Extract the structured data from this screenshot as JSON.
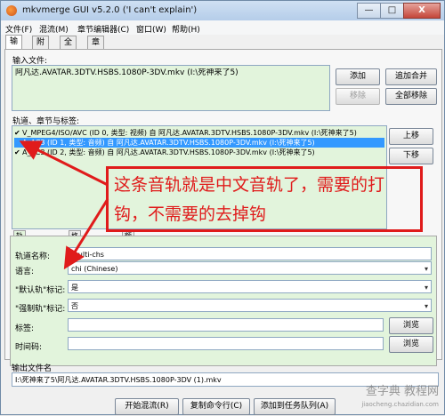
{
  "window": {
    "title": "mkvmerge GUI v5.2.0 ('I can't explain')"
  },
  "window_controls": {
    "minimize": "—",
    "maximize": "□",
    "close": "X"
  },
  "menu": [
    "文件(F)",
    "混流(M)",
    "章节编辑器(C)",
    "窗口(W)",
    "帮助(H)"
  ],
  "tabs": [
    "输入",
    "附件",
    "全局",
    "章节编辑器"
  ],
  "input": {
    "label": "输入文件:",
    "files": [
      "阿凡达.AVATAR.3DTV.HSBS.1080P-3DV.mkv (I:\\死神来了5)"
    ],
    "buttons": {
      "add": "添加",
      "append": "追加合并",
      "remove": "移除",
      "remove_all": "全部移除"
    }
  },
  "tracks": {
    "label": "轨道、章节与标签:",
    "items": [
      {
        "checked": true,
        "text": "V_MPEG4/ISO/AVC (ID 0, 类型: 视频) 自 阿凡达.AVATAR.3DTV.HSBS.1080P-3DV.mkv (I:\\死神来了5)"
      },
      {
        "checked": false,
        "text": "A_AC3 (ID 1, 类型: 音频) 自 阿凡达.AVATAR.3DTV.HSBS.1080P-3DV.mkv (I:\\死神来了5)"
      },
      {
        "checked": true,
        "text": "A_AC3 (ID 2, 类型: 音频) 自 阿凡达.AVATAR.3DTV.HSBS.1080P-3DV.mkv (I:\\死神来了5)"
      }
    ],
    "buttons": {
      "up": "上移",
      "down": "下移"
    }
  },
  "annotation": {
    "text": "这条音轨就是中文音轨了，需要的打钩，不需要的去掉钩",
    "color": "#e01b1b"
  },
  "track_options": {
    "tabs": [
      "轨道常规选项",
      "格式细节选项",
      "额外选项"
    ],
    "name_label": "轨道名称:",
    "name_value": "multi-chs",
    "language_label": "语言:",
    "language_value": "chi (Chinese)",
    "default_label": "\"默认轨\"标记:",
    "default_value": "是",
    "forced_label": "\"强制轨\"标记:",
    "forced_value": "否",
    "tags_label": "标签:",
    "timecode_label": "时间码:",
    "browse": "浏览"
  },
  "output": {
    "label": "输出文件名",
    "value": "I:\\死神来了5\\阿凡达.AVATAR.3DTV.HSBS.1080P-3DV (1).mkv"
  },
  "actions": {
    "start": "开始混流(R)",
    "copy_cmd": "复制命令行(C)",
    "add_job": "添加到任务队列(A)"
  },
  "watermark": {
    "line1": "查字典 教程网",
    "line2": "jiaocheng.chazidian.com"
  }
}
